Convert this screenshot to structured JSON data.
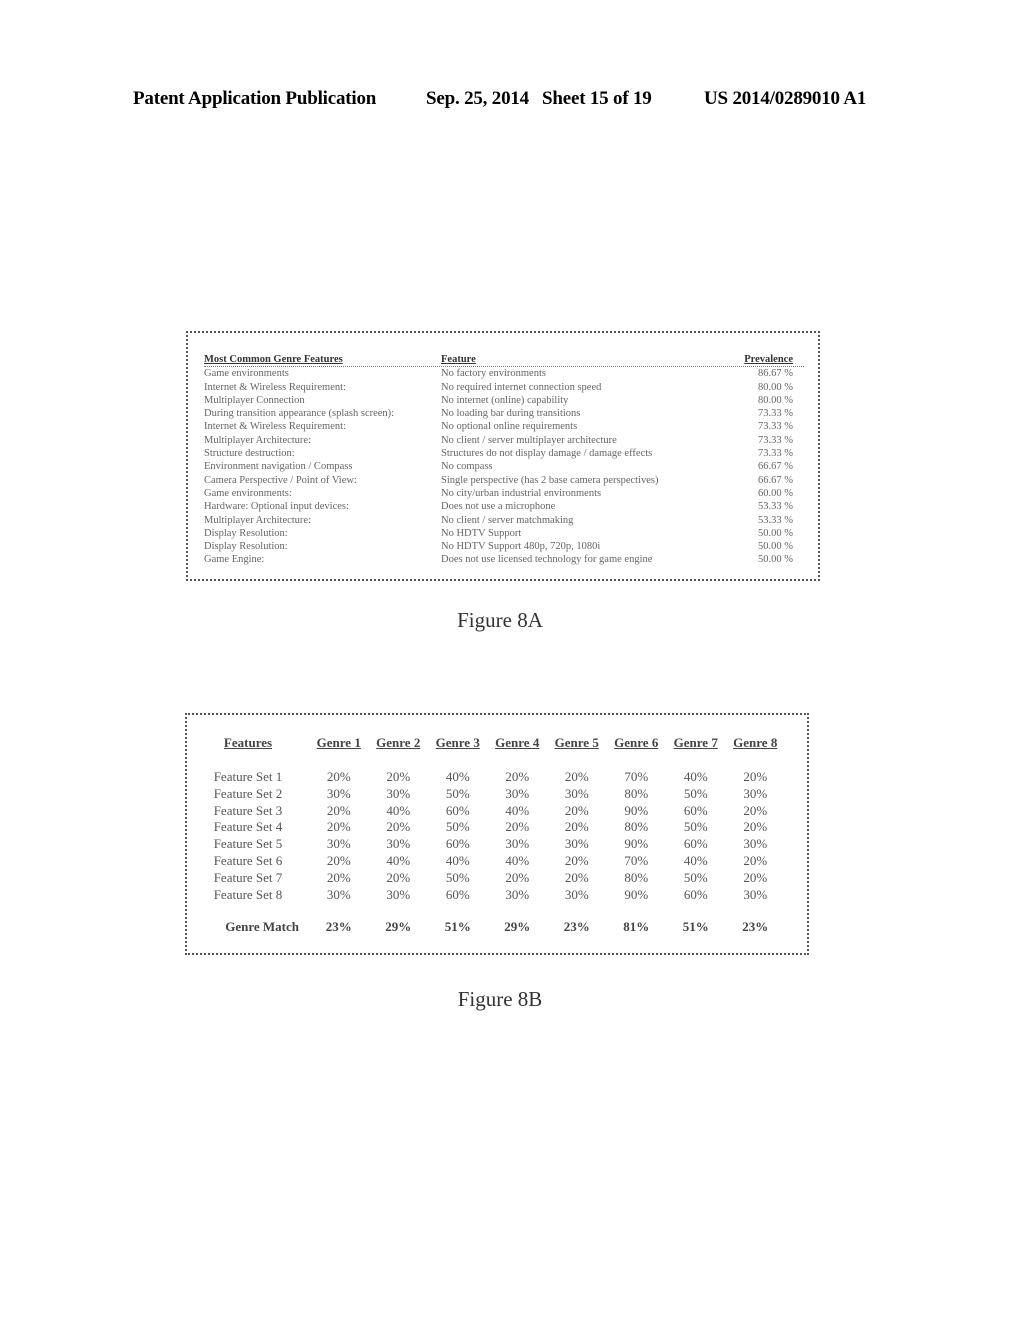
{
  "header": {
    "publication": "Patent Application Publication",
    "date": "Sep. 25, 2014",
    "sheet": "Sheet 15 of 19",
    "number": "US 2014/0289010 A1"
  },
  "figure_8a": {
    "caption": "Figure 8A",
    "columns": [
      "Most Common Genre Features",
      "Feature",
      "Prevalence"
    ],
    "rows": [
      [
        "Game environments",
        "No factory environments",
        "86.67 %"
      ],
      [
        "Internet & Wireless Requirement:",
        "No required internet connection speed",
        "80.00 %"
      ],
      [
        "Multiplayer Connection",
        "No internet (online) capability",
        "80.00 %"
      ],
      [
        "During transition appearance (splash screen):",
        "No loading bar during transitions",
        "73.33 %"
      ],
      [
        "Internet & Wireless Requirement:",
        "No optional online requirements",
        "73.33 %"
      ],
      [
        "Multiplayer Architecture:",
        "No client / server multiplayer architecture",
        "73.33 %"
      ],
      [
        "Structure destruction:",
        "Structures do not display damage / damage effects",
        "73.33 %"
      ],
      [
        "Environment navigation / Compass",
        "No compass",
        "66.67 %"
      ],
      [
        "Camera Perspective / Point of View:",
        "Single perspective (has 2 base camera perspectives)",
        "66.67 %"
      ],
      [
        "Game environments:",
        "No city/urban industrial environments",
        "60.00 %"
      ],
      [
        "Hardware: Optional input devices:",
        "Does not use a microphone",
        "53.33 %"
      ],
      [
        "Multiplayer Architecture:",
        "No client / server matchmaking",
        "53.33 %"
      ],
      [
        "Display Resolution:",
        "No HDTV Support",
        "50.00 %"
      ],
      [
        "Display Resolution:",
        "No HDTV Support 480p, 720p, 1080i",
        "50.00 %"
      ],
      [
        "Game Engine:",
        "Does not use licensed technology for game engine",
        "50.00 %"
      ]
    ]
  },
  "figure_8b": {
    "caption": "Figure 8B",
    "header_label": "Features",
    "genres": [
      "Genre 1",
      "Genre 2",
      "Genre 3",
      "Genre 4",
      "Genre 5",
      "Genre 6",
      "Genre 7",
      "Genre 8"
    ],
    "rows": [
      {
        "label": "Feature Set 1",
        "values": [
          "20%",
          "20%",
          "40%",
          "20%",
          "20%",
          "70%",
          "40%",
          "20%"
        ]
      },
      {
        "label": "Feature Set 2",
        "values": [
          "30%",
          "30%",
          "50%",
          "30%",
          "30%",
          "80%",
          "50%",
          "30%"
        ]
      },
      {
        "label": "Feature Set 3",
        "values": [
          "20%",
          "40%",
          "60%",
          "40%",
          "20%",
          "90%",
          "60%",
          "20%"
        ]
      },
      {
        "label": "Feature Set 4",
        "values": [
          "20%",
          "20%",
          "50%",
          "20%",
          "20%",
          "80%",
          "50%",
          "20%"
        ]
      },
      {
        "label": "Feature Set 5",
        "values": [
          "30%",
          "30%",
          "60%",
          "30%",
          "30%",
          "90%",
          "60%",
          "30%"
        ]
      },
      {
        "label": "Feature Set 6",
        "values": [
          "20%",
          "40%",
          "40%",
          "40%",
          "20%",
          "70%",
          "40%",
          "20%"
        ]
      },
      {
        "label": "Feature Set 7",
        "values": [
          "20%",
          "20%",
          "50%",
          "20%",
          "20%",
          "80%",
          "50%",
          "20%"
        ]
      },
      {
        "label": "Feature Set 8",
        "values": [
          "30%",
          "30%",
          "60%",
          "30%",
          "30%",
          "90%",
          "60%",
          "30%"
        ]
      }
    ],
    "match": {
      "label": "Genre Match",
      "values": [
        "23%",
        "29%",
        "51%",
        "29%",
        "23%",
        "81%",
        "51%",
        "23%"
      ]
    }
  }
}
